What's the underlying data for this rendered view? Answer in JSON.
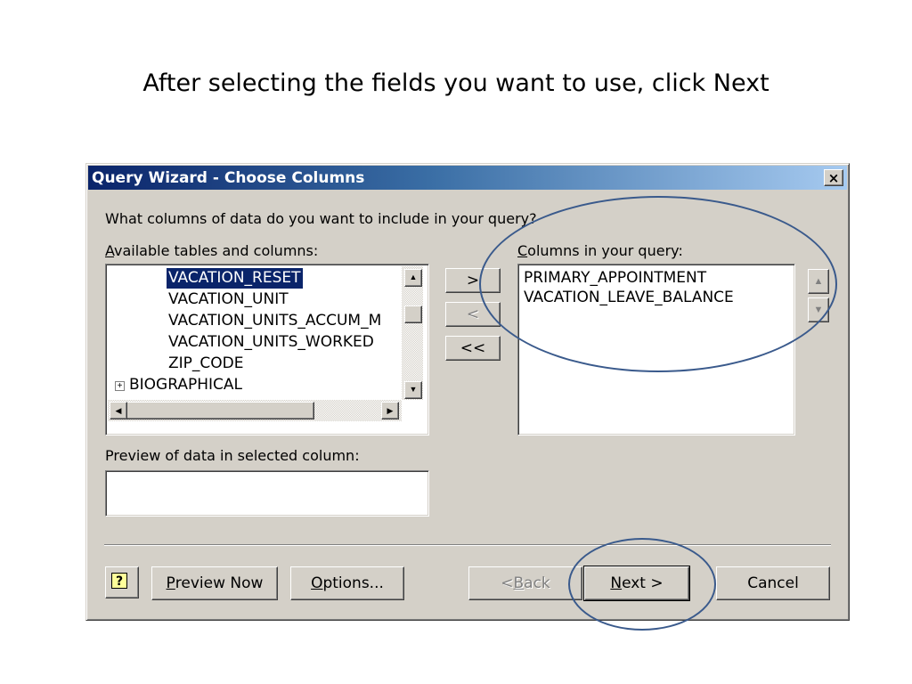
{
  "slide": {
    "title": "After selecting the fields you want to use, click Next"
  },
  "dialog": {
    "title": "Query Wizard - Choose Columns",
    "close_label": "×",
    "prompt": "What columns of data do you want to include in your query?",
    "available_label_accel": "A",
    "available_label_rest": "vailable tables and columns:",
    "available_items": [
      {
        "label": "VACATION_RESET",
        "selected": true
      },
      {
        "label": "VACATION_UNIT"
      },
      {
        "label": "VACATION_UNITS_ACCUM_M"
      },
      {
        "label": "VACATION_UNITS_WORKED"
      },
      {
        "label": "ZIP_CODE"
      }
    ],
    "available_group": {
      "expander": "+",
      "label": "BIOGRAPHICAL"
    },
    "move_buttons": {
      "add": ">",
      "remove": "<",
      "remove_all": "<<"
    },
    "query_label_accel": "C",
    "query_label_rest": "olumns in your query:",
    "query_items": [
      "PRIMARY_APPOINTMENT",
      "VACATION_LEAVE_BALANCE"
    ],
    "preview_label": "Preview of data in selected column:",
    "preview_value": "",
    "buttons": {
      "help": "?",
      "preview_accel": "P",
      "preview_rest": "review Now",
      "options_accel": "O",
      "options_rest": "ptions...",
      "back_prefix": "< ",
      "back_accel": "B",
      "back_rest": "ack",
      "next_accel": "N",
      "next_rest": "ext >",
      "cancel": "Cancel"
    },
    "scroll_glyphs": {
      "up": "▲",
      "down": "▼",
      "left": "◀",
      "right": "▶"
    }
  },
  "colors": {
    "highlight": "#0a246a",
    "annotation": "#3a5a8c",
    "face": "#d4d0c8"
  }
}
